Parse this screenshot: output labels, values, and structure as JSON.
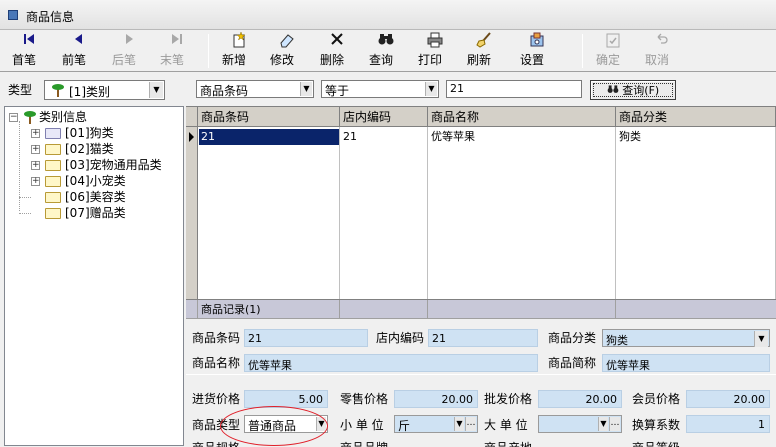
{
  "window": {
    "title": "商品信息"
  },
  "toolbar": {
    "first": "首笔",
    "prev": "前笔",
    "next": "后笔",
    "last": "末笔",
    "add": "新增",
    "edit": "修改",
    "delete": "删除",
    "query": "查询",
    "print": "打印",
    "refresh": "刷新",
    "settings": "设置",
    "confirm": "确定",
    "cancel": "取消"
  },
  "left": {
    "type_label": "类型",
    "type_value": "[1]类别",
    "tree": {
      "root": "类别信息",
      "items": [
        "[01]狗类",
        "[02]猫类",
        "[03]宠物通用品类",
        "[04]小宠类",
        "[06]美容类",
        "[07]赠品类"
      ]
    }
  },
  "filter": {
    "field": "商品条码",
    "operator": "等于",
    "value": "21",
    "query_button": "查询(F)"
  },
  "grid": {
    "columns": [
      "商品条码",
      "店内编码",
      "商品名称",
      "商品分类"
    ],
    "rows": [
      [
        "21",
        "21",
        "优等苹果",
        "狗类"
      ]
    ],
    "footer": "商品记录(1)"
  },
  "detail": {
    "barcode_label": "商品条码",
    "barcode": "21",
    "store_code_label": "店内编码",
    "store_code": "21",
    "category_label": "商品分类",
    "category": "狗类",
    "name_label": "商品名称",
    "name": "优等苹果",
    "short_name_label": "商品简称",
    "short_name": "优等苹果",
    "purchase_price_label": "进货价格",
    "purchase_price": "5.00",
    "retail_price_label": "零售价格",
    "retail_price": "20.00",
    "wholesale_price_label": "批发价格",
    "wholesale_price": "20.00",
    "member_price_label": "会员价格",
    "member_price": "20.00",
    "type_label": "商品类型",
    "type": "普通商品",
    "small_unit_label": "小 单 位",
    "small_unit": "斤",
    "big_unit_label": "大 单 位",
    "big_unit": "",
    "conversion_label": "换算系数",
    "conversion": "1",
    "spec_label": "商品规格",
    "brand_label": "商品品牌",
    "origin_label": "商品产地",
    "grade_label": "商品等级"
  }
}
